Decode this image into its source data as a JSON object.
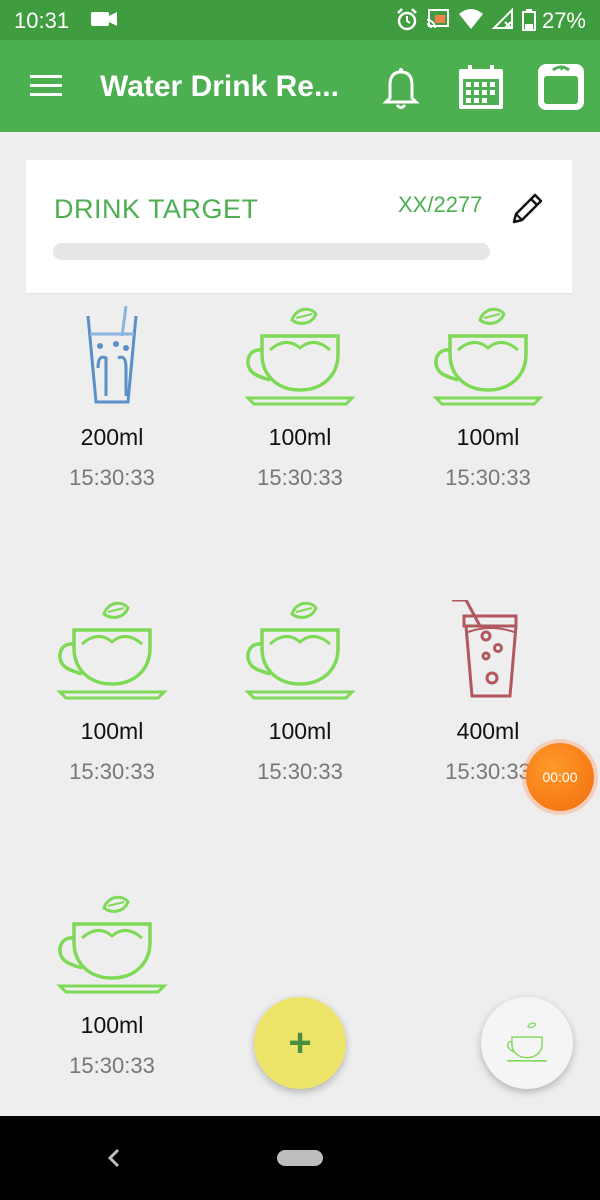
{
  "status_bar": {
    "time": "10:31",
    "battery": "27%",
    "icons": [
      "camera-icon",
      "alarm-icon",
      "cast-icon",
      "wifi-icon",
      "signal-icon",
      "battery-icon"
    ]
  },
  "app_bar": {
    "title": "Water Drink Re...",
    "color": "#4caf50",
    "actions": [
      "bell-icon",
      "calendar-icon",
      "scale-icon"
    ]
  },
  "target": {
    "label": "DRINK TARGET",
    "value": "XX/2277",
    "progress": 0
  },
  "drinks": [
    {
      "type": "water",
      "amount": "200ml",
      "time": "15:30:33"
    },
    {
      "type": "tea",
      "amount": "100ml",
      "time": "15:30:33"
    },
    {
      "type": "tea",
      "amount": "100ml",
      "time": "15:30:33"
    },
    {
      "type": "tea",
      "amount": "100ml",
      "time": "15:30:33"
    },
    {
      "type": "tea",
      "amount": "100ml",
      "time": "15:30:33"
    },
    {
      "type": "juice",
      "amount": "400ml",
      "time": "15:30:33"
    },
    {
      "type": "tea",
      "amount": "100ml",
      "time": "15:30:33"
    }
  ],
  "timer": {
    "label": "00:00"
  },
  "fab": {
    "add_label": "+"
  },
  "colors": {
    "accent": "#4caf50",
    "tea": "#7ed957",
    "water": "#5b8fc7",
    "juice": "#b0585e",
    "timer": "#f57c14",
    "fab": "#ede46a"
  }
}
